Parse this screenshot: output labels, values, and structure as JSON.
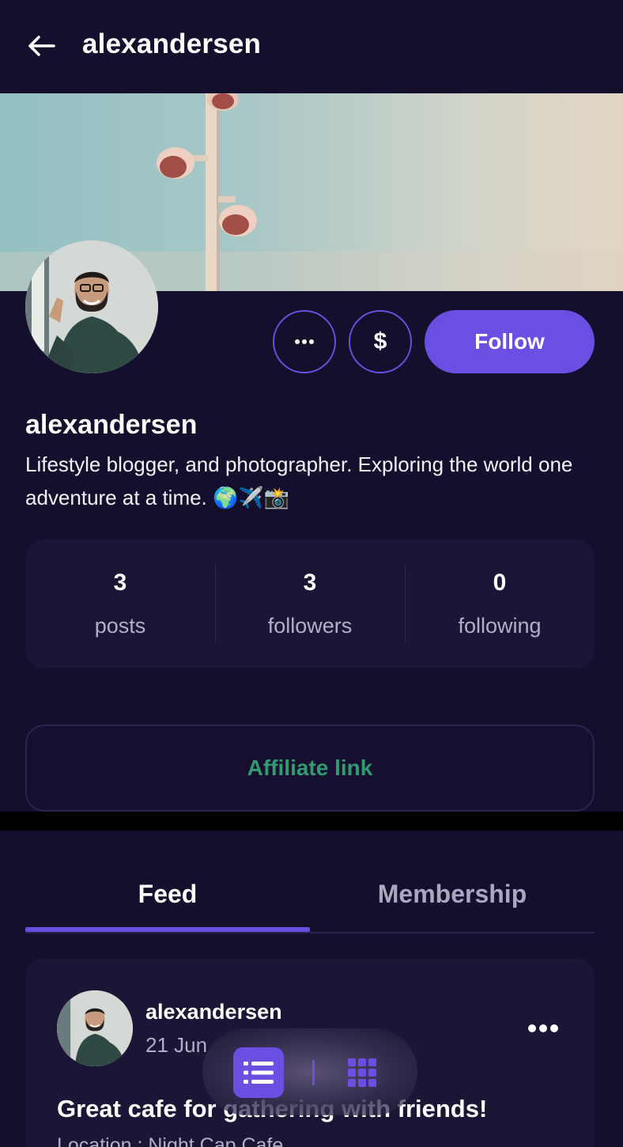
{
  "header": {
    "title": "alexandersen",
    "back_icon": "arrow-left-icon"
  },
  "profile": {
    "username": "alexandersen",
    "bio": "Lifestyle blogger, and photographer. Exploring the world one adventure at a time. 🌍✈️📸",
    "more_icon": "ellipsis-icon",
    "tip_label": "$",
    "follow_label": "Follow"
  },
  "stats": [
    {
      "value": "3",
      "label": "posts"
    },
    {
      "value": "3",
      "label": "followers"
    },
    {
      "value": "0",
      "label": "following"
    }
  ],
  "affiliate": {
    "label": "Affiliate link"
  },
  "tabs": [
    {
      "label": "Feed",
      "active": true
    },
    {
      "label": "Membership",
      "active": false
    }
  ],
  "post": {
    "author": "alexandersen",
    "date": "21 Jun",
    "title": "Great cafe for gathering with friends!",
    "location": "Location : Night Cap Cafe"
  },
  "view_switcher": {
    "active": "list",
    "list_icon": "list-view-icon",
    "grid_icon": "grid-view-icon"
  },
  "colors": {
    "background": "#140f2c",
    "card": "#1b1635",
    "accent": "#6b4fe3",
    "affiliate": "#2f9b6e",
    "muted": "#b4afc6"
  }
}
